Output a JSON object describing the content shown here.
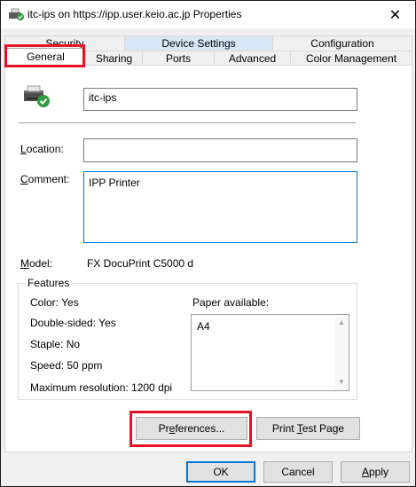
{
  "window": {
    "title": "itc-ips on https://ipp.user.keio.ac.jp Properties"
  },
  "tabs": {
    "back": [
      {
        "label": "Security"
      },
      {
        "label": "Device Settings"
      },
      {
        "label": "Configuration"
      }
    ],
    "front": [
      {
        "label": "General"
      },
      {
        "label": "Sharing"
      },
      {
        "label": "Ports"
      },
      {
        "label": "Advanced"
      },
      {
        "label": "Color Management"
      }
    ],
    "selected": "General"
  },
  "general": {
    "printer_name": "itc-ips",
    "location_label": "Location:",
    "location_value": "",
    "comment_label": "Comment:",
    "comment_value": "IPP Printer",
    "model_label": "Model:",
    "model_value": "FX DocuPrint C5000 d",
    "features_title": "Features",
    "features": [
      {
        "text": "Color: Yes"
      },
      {
        "text": "Double-sided: Yes"
      },
      {
        "text": "Staple: No"
      },
      {
        "text": "Speed: 50 ppm"
      },
      {
        "text": "Maximum resolution: 1200 dpi"
      }
    ],
    "paper_label": "Paper available:",
    "paper_items": [
      "A4"
    ],
    "preferences_button": "Preferences...",
    "print_test_button": "Print Test Page"
  },
  "footer": {
    "ok": "OK",
    "cancel": "Cancel",
    "apply": "Apply"
  },
  "colors": {
    "highlight_box": "#e81123",
    "focus_border": "#0078d7"
  }
}
